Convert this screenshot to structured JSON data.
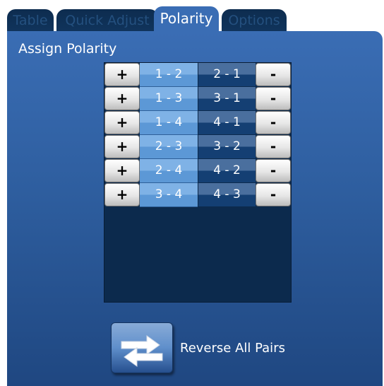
{
  "tabs": [
    {
      "label": "Table"
    },
    {
      "label": "Quick Adjust"
    },
    {
      "label": "Polarity",
      "active": true
    },
    {
      "label": "Options"
    }
  ],
  "panel": {
    "title": "Assign Polarity"
  },
  "buttons": {
    "plus_label": "+",
    "minus_label": "-"
  },
  "pairs": [
    {
      "forward": "1 - 2",
      "reverse": "2 - 1"
    },
    {
      "forward": "1 - 3",
      "reverse": "3 - 1"
    },
    {
      "forward": "1 - 4",
      "reverse": "4 - 1"
    },
    {
      "forward": "2 - 3",
      "reverse": "3 - 2"
    },
    {
      "forward": "2 - 4",
      "reverse": "4 - 2"
    },
    {
      "forward": "3 - 4",
      "reverse": "4 - 3"
    }
  ],
  "reverse_all": {
    "label": "Reverse All Pairs",
    "icon": "swap-arrows-icon"
  },
  "colors": {
    "panel_top": "#3a6db4",
    "panel_bottom": "#1f4781",
    "table_bg": "#0c2a4d",
    "forward_cell": "#6ca6e0",
    "reverse_cell": "#1d4a80"
  }
}
